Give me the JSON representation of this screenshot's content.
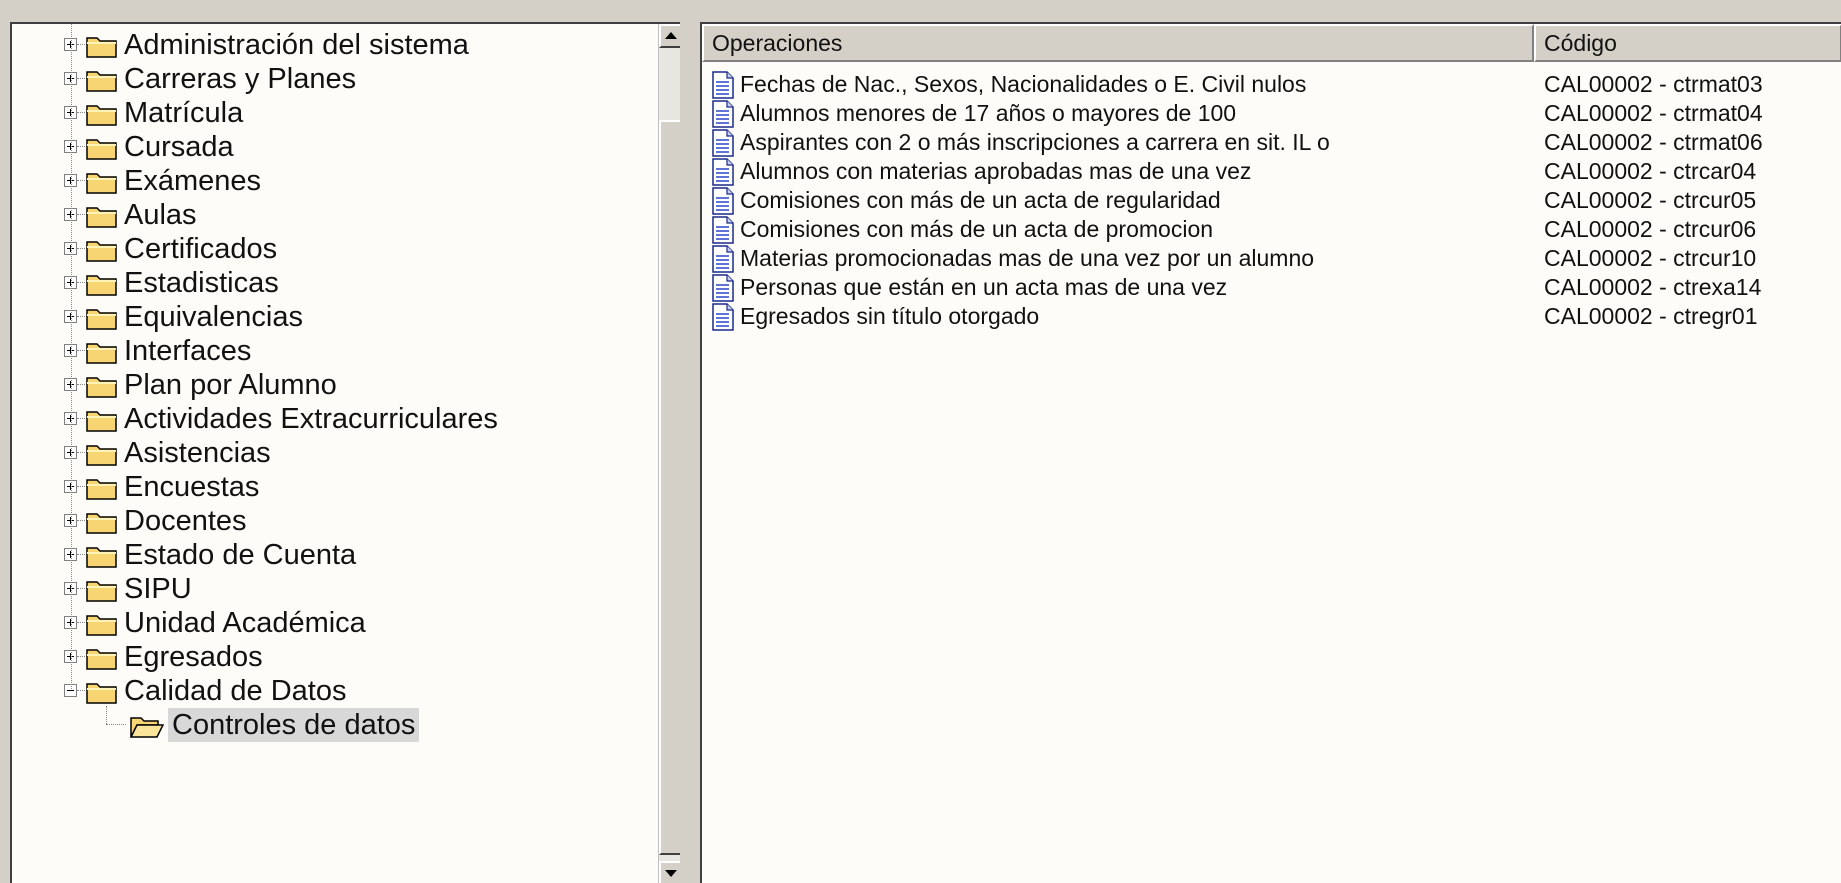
{
  "tree": {
    "items": [
      {
        "label": "Administración del sistema",
        "expanded": false
      },
      {
        "label": "Carreras y Planes",
        "expanded": false
      },
      {
        "label": "Matrícula",
        "expanded": false
      },
      {
        "label": "Cursada",
        "expanded": false
      },
      {
        "label": "Exámenes",
        "expanded": false
      },
      {
        "label": "Aulas",
        "expanded": false
      },
      {
        "label": "Certificados",
        "expanded": false
      },
      {
        "label": "Estadisticas",
        "expanded": false
      },
      {
        "label": "Equivalencias",
        "expanded": false
      },
      {
        "label": "Interfaces",
        "expanded": false
      },
      {
        "label": "Plan por Alumno",
        "expanded": false
      },
      {
        "label": "Actividades Extracurriculares",
        "expanded": false
      },
      {
        "label": "Asistencias",
        "expanded": false
      },
      {
        "label": "Encuestas",
        "expanded": false
      },
      {
        "label": "Docentes",
        "expanded": false
      },
      {
        "label": "Estado de Cuenta",
        "expanded": false
      },
      {
        "label": "SIPU",
        "expanded": false
      },
      {
        "label": "Unidad Académica",
        "expanded": false
      },
      {
        "label": "Egresados",
        "expanded": false
      },
      {
        "label": "Calidad de Datos",
        "expanded": true
      }
    ],
    "child": {
      "label": "Controles de datos",
      "selected": true
    }
  },
  "list": {
    "columns": [
      "Operaciones",
      "Código"
    ],
    "rows": [
      {
        "operation": "Fechas de Nac., Sexos, Nacionalidades o E. Civil nulos",
        "code": "CAL00002 - ctrmat03"
      },
      {
        "operation": "Alumnos menores de 17 años o mayores de 100",
        "code": "CAL00002 - ctrmat04"
      },
      {
        "operation": "Aspirantes con 2 o más inscripciones a carrera en sit. IL o",
        "code": "CAL00002 - ctrmat06"
      },
      {
        "operation": "Alumnos con materias aprobadas mas de una vez",
        "code": "CAL00002 - ctrcar04"
      },
      {
        "operation": "Comisiones con más de un acta de regularidad",
        "code": "CAL00002 - ctrcur05"
      },
      {
        "operation": "Comisiones con más de un acta de promocion",
        "code": "CAL00002 - ctrcur06"
      },
      {
        "operation": "Materias promocionadas mas de una vez por un alumno",
        "code": "CAL00002 - ctrcur10"
      },
      {
        "operation": "Personas que están en un acta mas de una vez",
        "code": "CAL00002 - ctrexa14"
      },
      {
        "operation": "Egresados sin título otorgado",
        "code": "CAL00002 - ctregr01"
      }
    ]
  },
  "icons": {
    "folder": "folder-icon",
    "open_folder": "open-folder-icon",
    "document": "document-icon",
    "expand": "plus-expander-icon",
    "collapse": "minus-expander-icon"
  },
  "colors": {
    "window_bg": "#d4d0c8",
    "panel_bg": "#fdfcf8",
    "folder_fill": "#f7d572",
    "selected_bg": "#d8d8d8"
  }
}
